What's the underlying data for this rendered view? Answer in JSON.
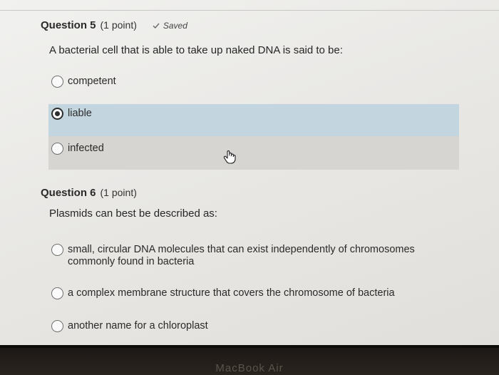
{
  "status": {
    "saved_label": "Saved",
    "saved_icon": "checkmark-icon"
  },
  "questions": [
    {
      "title": "Question 5",
      "points": "(1 point)",
      "prompt": "A bacterial cell that is able to take up naked DNA is said to be:",
      "selected_index": 1,
      "options": [
        {
          "label": "competent"
        },
        {
          "label": "liable"
        },
        {
          "label": "infected"
        }
      ]
    },
    {
      "title": "Question 6",
      "points": "(1 point)",
      "prompt": "Plasmids can best be described as:",
      "options": [
        {
          "label": "small, circular DNA molecules that can exist independently of chromosomes commonly found in bacteria"
        },
        {
          "label": "a complex membrane structure that covers the chromosome of bacteria"
        },
        {
          "label": "another name for a chloroplast"
        }
      ]
    }
  ],
  "colors": {
    "selected_row": "#c3d6df",
    "hover_row": "#d6d5d2",
    "bezel": "#1b1714"
  },
  "device": {
    "brand_text": "MacBook Air"
  }
}
